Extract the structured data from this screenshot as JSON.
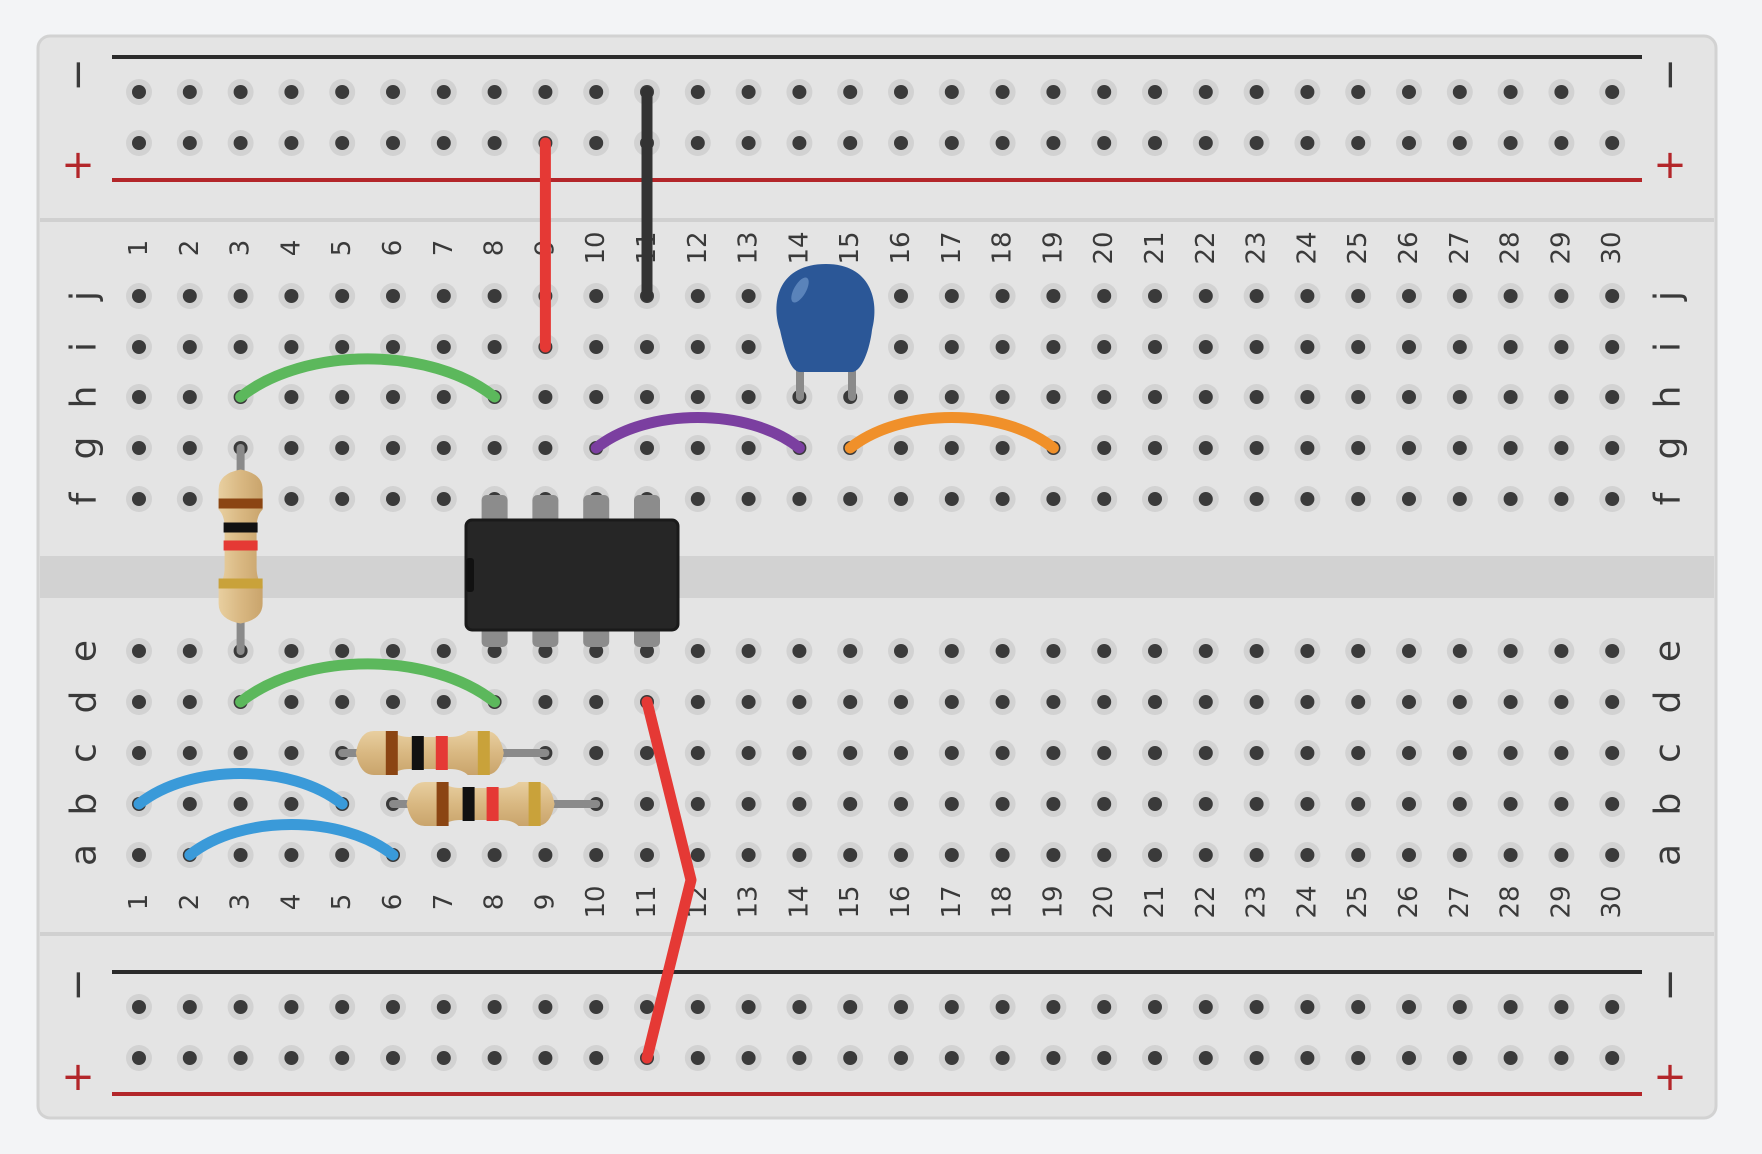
{
  "breadboard": {
    "columns": [
      "1",
      "2",
      "3",
      "4",
      "5",
      "6",
      "7",
      "8",
      "9",
      "10",
      "11",
      "12",
      "13",
      "14",
      "15",
      "16",
      "17",
      "18",
      "19",
      "20",
      "21",
      "22",
      "23",
      "24",
      "25",
      "26",
      "27",
      "28",
      "29",
      "30"
    ],
    "top_rows": [
      "j",
      "i",
      "h",
      "g",
      "f"
    ],
    "bottom_rows": [
      "e",
      "d",
      "c",
      "b",
      "a"
    ],
    "rail_minus_label": "−",
    "rail_plus_label": "+",
    "colors": {
      "board": "#e4e4e4",
      "rail_minus": "#2b2b2b",
      "rail_plus": "#b3262a",
      "hole": "#3a3a3a"
    }
  },
  "components": {
    "ic": {
      "name": "DIP-8 IC",
      "pins_top": [
        "8",
        "9",
        "10",
        "11"
      ],
      "pins_bottom": [
        "8",
        "9",
        "10",
        "11"
      ],
      "color": "#262626"
    },
    "capacitor": {
      "name": "ceramic capacitor",
      "color": "#2b5797",
      "legs": [
        "14",
        "15"
      ],
      "row": "h"
    },
    "resistors": [
      {
        "id": "r1",
        "orientation": "vertical",
        "column": "3",
        "from_row": "g",
        "to_row": "e",
        "bands": [
          "#8b4513",
          "#111111",
          "#e53935",
          "#c9a23a"
        ]
      },
      {
        "id": "r2",
        "orientation": "horizontal",
        "row": "c",
        "from_column": "5",
        "to_column": "9",
        "bands": [
          "#8b4513",
          "#111111",
          "#e53935",
          "#c9a23a"
        ]
      },
      {
        "id": "r3",
        "orientation": "horizontal",
        "row": "b",
        "from_column": "6",
        "to_column": "10",
        "bands": [
          "#8b4513",
          "#111111",
          "#e53935",
          "#c9a23a"
        ]
      }
    ],
    "wires": [
      {
        "id": "red-top",
        "color": "#e53935",
        "from": "rail+ 9",
        "to": "i9"
      },
      {
        "id": "black-top",
        "color": "#333333",
        "from": "rail- 11",
        "to": "j11"
      },
      {
        "id": "green-h",
        "color": "#5cb85c",
        "from": "h3",
        "to": "h8"
      },
      {
        "id": "purple-g",
        "color": "#7b3fa0",
        "from": "g10",
        "to": "g14"
      },
      {
        "id": "orange-g",
        "color": "#f0902a",
        "from": "g15",
        "to": "g19"
      },
      {
        "id": "green-d",
        "color": "#5cb85c",
        "from": "d3",
        "to": "d8"
      },
      {
        "id": "blue-b",
        "color": "#3a9ad9",
        "from": "b1",
        "to": "b5"
      },
      {
        "id": "blue-a",
        "color": "#3a9ad9",
        "from": "a2",
        "to": "a6"
      },
      {
        "id": "red-bottom",
        "color": "#e53935",
        "from": "d11",
        "to": "rail+ 11"
      }
    ]
  }
}
